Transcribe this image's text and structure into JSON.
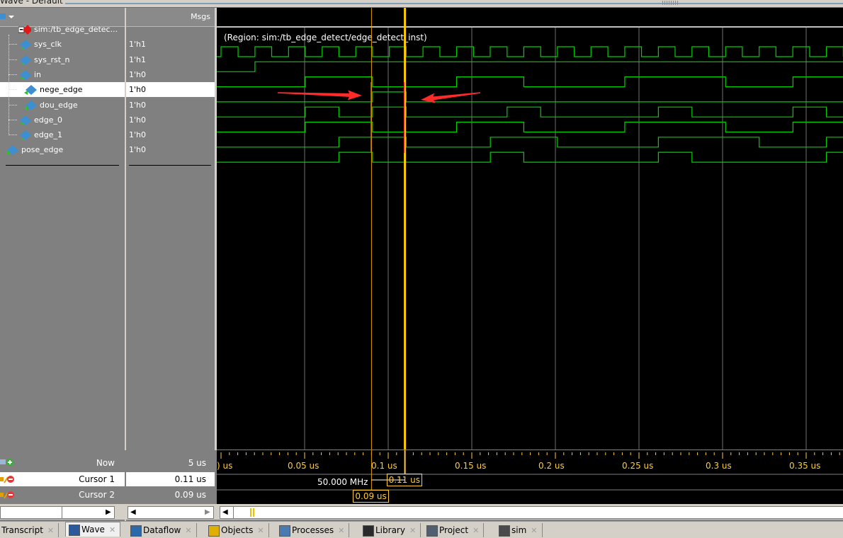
{
  "window": {
    "title": "Wave - Default"
  },
  "header": {
    "msgs_label": "Msgs"
  },
  "signals": [
    {
      "name": "sim:/tb_edge_detec...",
      "value": "",
      "kind": "instance",
      "expander": "-"
    },
    {
      "name": "sys_clk",
      "value": "1'h1",
      "kind": "input"
    },
    {
      "name": "sys_rst_n",
      "value": "1'h1",
      "kind": "input"
    },
    {
      "name": "in",
      "value": "1'h0",
      "kind": "input"
    },
    {
      "name": "nege_edge",
      "value": "1'h0",
      "kind": "output",
      "selected": true
    },
    {
      "name": "dou_edge",
      "value": "1'h0",
      "kind": "output"
    },
    {
      "name": "edge_0",
      "value": "1'h0",
      "kind": "input"
    },
    {
      "name": "edge_1",
      "value": "1'h0",
      "kind": "input"
    },
    {
      "name": "pose_edge",
      "value": "1'h0",
      "kind": "output"
    }
  ],
  "wave": {
    "region_label": "(Region: sim:/tb_edge_detect/edge_detect_inst)",
    "timescale": {
      "start_us": 0,
      "end_us": 0.372
    },
    "ticks": [
      {
        "t": 0.0,
        "label": ") us"
      },
      {
        "t": 0.05,
        "label": "0.05 us"
      },
      {
        "t": 0.1,
        "label": "0.1 us"
      },
      {
        "t": 0.15,
        "label": "0.15 us"
      },
      {
        "t": 0.2,
        "label": "0.2 us"
      },
      {
        "t": 0.25,
        "label": "0.25 us"
      },
      {
        "t": 0.3,
        "label": "0.3 us"
      },
      {
        "t": 0.35,
        "label": "0.35 us"
      }
    ],
    "traces": {
      "sys_clk": {
        "initial": 0,
        "edges": [
          0.0,
          0.0102,
          0.0203,
          0.0303,
          0.0404,
          0.0504,
          0.0605,
          0.0705,
          0.0806,
          0.0906,
          0.1007,
          0.1107,
          0.1208,
          0.1309,
          0.1409,
          0.151,
          0.161,
          0.1711,
          0.1811,
          0.1912,
          0.2012,
          0.2113,
          0.2213,
          0.2314,
          0.2415,
          0.2515,
          0.2616,
          0.2716,
          0.2817,
          0.2917,
          0.3018,
          0.3118,
          0.3219,
          0.3319,
          0.342,
          0.3521,
          0.3621,
          0.3722
        ]
      },
      "sys_rst_n": {
        "initial": 0,
        "edges": [
          0.0203
        ]
      },
      "in": {
        "initial": 0,
        "edges": [
          0.0504,
          0.0906,
          0.1409,
          0.1811,
          0.2415,
          0.3018,
          0.3421
        ]
      },
      "nege_edge": {
        "initial": 0,
        "edges": [
          0.0906,
          0.1107
        ]
      },
      "dou_edge": {
        "initial": 0,
        "edges": [
          0.0504,
          0.0705,
          0.0906,
          0.1107,
          0.1711,
          0.1912,
          0.2616,
          0.2817,
          0.3421,
          0.3621
        ]
      },
      "edge_0": {
        "initial": 0,
        "edges": [
          0.0504,
          0.0906,
          0.1409,
          0.1811,
          0.2415,
          0.3018,
          0.3421
        ]
      },
      "edge_1": {
        "initial": 0,
        "edges": [
          0.0705,
          0.1107,
          0.1611,
          0.2012,
          0.2616,
          0.3219,
          0.3621
        ]
      },
      "pose_edge": {
        "initial": 0,
        "edges": [
          0.0705,
          0.0906,
          0.1611,
          0.1811,
          0.2616,
          0.2817,
          0.3621
        ]
      }
    },
    "cursors": [
      {
        "t": 0.09
      },
      {
        "t": 0.11
      }
    ],
    "annotation_arrows": 2,
    "colors": {
      "trace": "#00d000",
      "cursor_active": "#ffcc00",
      "cursor_inactive": "#e0a000",
      "grid": "#707070",
      "arrow": "#ff2a2a"
    }
  },
  "cursor_pane": {
    "now_label": "Now",
    "now_value": "5 us",
    "cursors": [
      {
        "label": "Cursor 1",
        "value": "0.11 us"
      },
      {
        "label": "Cursor 2",
        "value": "0.09 us"
      }
    ],
    "freq_label": "50.000 MHz",
    "cursor1_box": "0.11 us",
    "cursor2_box": "0.09 us"
  },
  "tabs": [
    {
      "label": "Transcript",
      "icon": "transcript-icon"
    },
    {
      "label": "Wave",
      "icon": "wave-icon",
      "active": true
    },
    {
      "label": "Dataflow",
      "icon": "dataflow-icon"
    },
    {
      "label": "Objects",
      "icon": "objects-icon"
    },
    {
      "label": "Processes",
      "icon": "processes-icon"
    },
    {
      "label": "Library",
      "icon": "library-icon"
    },
    {
      "label": "Project",
      "icon": "project-icon"
    },
    {
      "label": "sim",
      "icon": "sim-icon"
    }
  ]
}
